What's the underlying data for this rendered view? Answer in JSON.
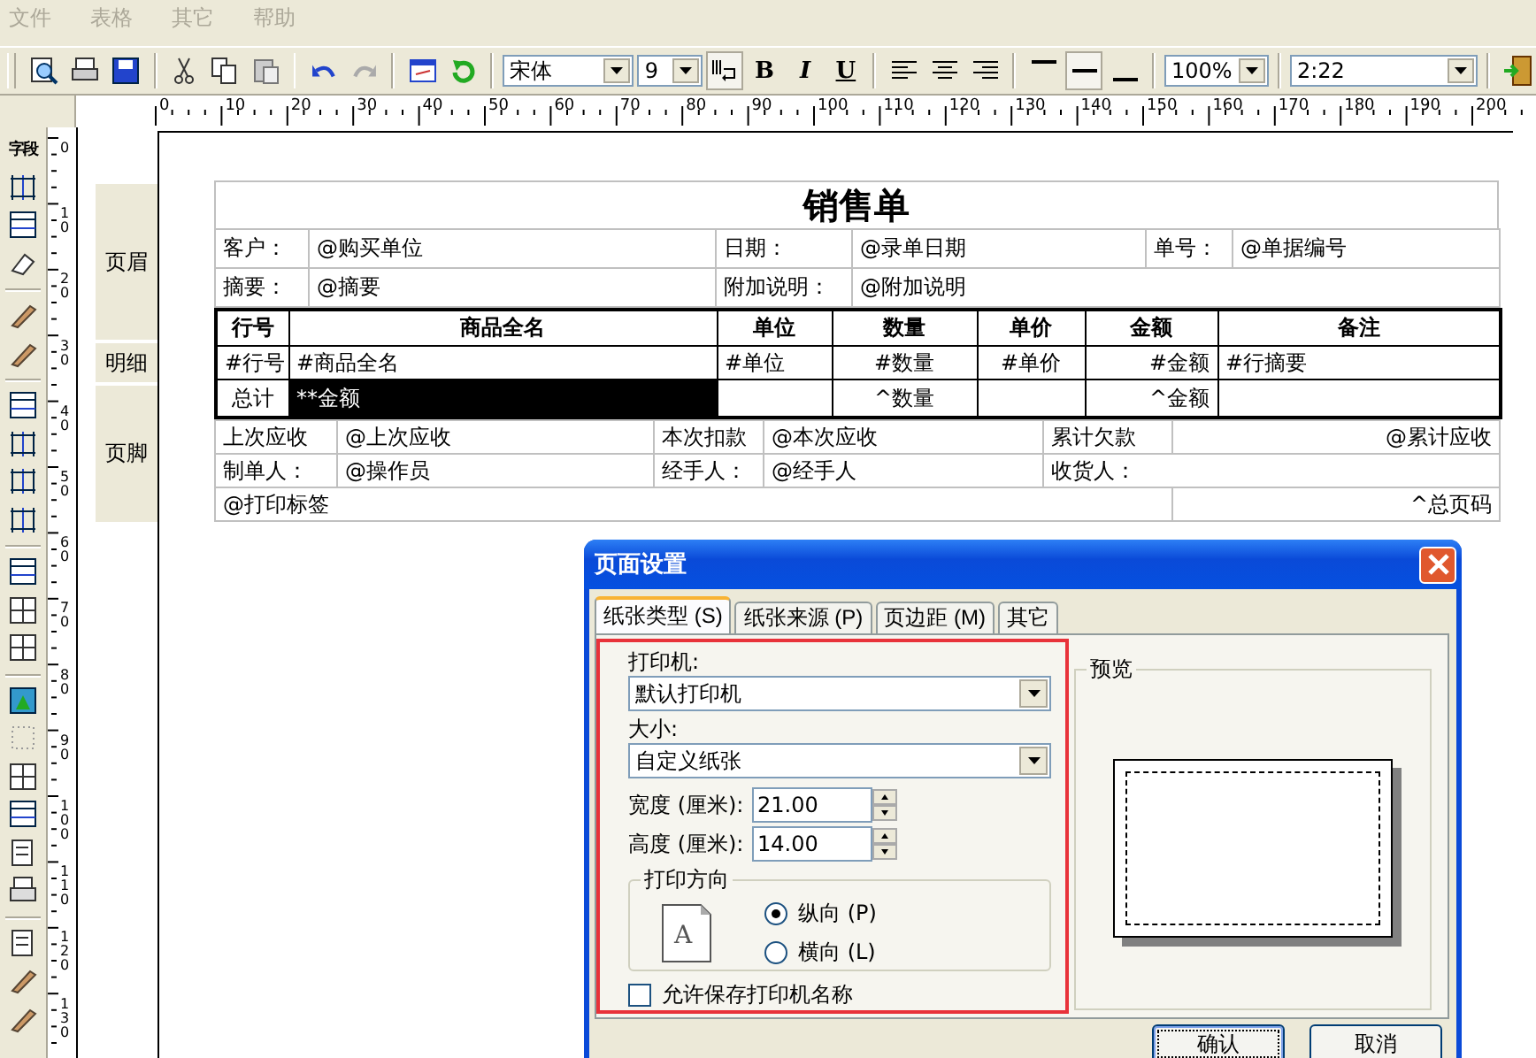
{
  "menu": [
    {
      "label": "文件",
      "disabled": true
    },
    {
      "label": "表格",
      "disabled": true
    },
    {
      "label": "其它",
      "disabled": true
    },
    {
      "label": "帮助",
      "disabled": true
    }
  ],
  "toolbar": {
    "font": "宋体",
    "font_size": "9",
    "format_buttons": [
      "B",
      "I",
      "U"
    ],
    "zoom": "100%",
    "position": "2:22"
  },
  "ruler": {
    "horizontal": [
      "0",
      "10",
      "20",
      "30",
      "40",
      "50",
      "60",
      "70",
      "80",
      "90",
      "100",
      "110",
      "120",
      "130",
      "140",
      "150",
      "160",
      "170",
      "180",
      "190",
      "200"
    ],
    "vertical": [
      "0",
      "10",
      "20",
      "30",
      "40",
      "50",
      "60",
      "70",
      "80",
      "90",
      "100",
      "110",
      "120",
      "130"
    ]
  },
  "left_toolbar": {
    "field_button": "字段"
  },
  "bands": [
    "页眉",
    "明细",
    "页脚"
  ],
  "report": {
    "title": "销售单",
    "header_rows": [
      [
        "客户：",
        "@购买单位",
        "日期：",
        "@录单日期",
        "单号：",
        "@单据编号"
      ],
      [
        "摘要：",
        "@摘要",
        "附加说明：",
        "@附加说明"
      ]
    ],
    "detail_columns": [
      "行号",
      "商品全名",
      "单位",
      "数量",
      "单价",
      "金额",
      "备注"
    ],
    "detail_row": [
      "#行号",
      "#商品全名",
      "#单位",
      "#数量",
      "#单价",
      "#金额",
      "#行摘要"
    ],
    "total_row": [
      {
        "text": "总计",
        "selected": false
      },
      {
        "text": "**金额",
        "selected": true
      },
      {
        "selected": false
      },
      {
        "text": "^数量",
        "selected": false
      },
      {
        "selected": false
      },
      {
        "text": "^金额",
        "selected": false
      },
      {
        "selected": false
      }
    ],
    "footer_rows": [
      [
        "上次应收",
        "@上次应收",
        "本次扣款",
        "@本次应收",
        "累计欠款",
        "@累计应收"
      ],
      [
        "制单人：",
        "@操作员",
        "经手人：",
        "@经手人",
        "收货人："
      ],
      [
        "@打印标签",
        "^总页码"
      ]
    ]
  },
  "dialog": {
    "title": "页面设置",
    "tabs": [
      {
        "label": "纸张类型 (S)",
        "selected": true
      },
      {
        "label": "纸张来源 (P)",
        "selected": false
      },
      {
        "label": "页边距 (M)",
        "selected": false
      },
      {
        "label": "其它",
        "selected": false
      }
    ],
    "printer": {
      "label": "打印机:",
      "value": "默认打印机"
    },
    "size": {
      "label": "大小:",
      "value": "自定义纸张"
    },
    "width": {
      "label": "宽度 (厘米):",
      "value": "21.00"
    },
    "height": {
      "label": "高度 (厘米):",
      "value": "14.00"
    },
    "orientation": {
      "title": "打印方向",
      "icon_letter": "A",
      "options": [
        {
          "label": "纵向 (P)",
          "selected": true
        },
        {
          "label": "横向 (L)",
          "selected": false
        }
      ]
    },
    "save_printer_name": {
      "label": "允许保存打印机名称",
      "checked": false
    },
    "preview_title": "预览",
    "buttons": [
      "确认",
      "取消"
    ]
  }
}
